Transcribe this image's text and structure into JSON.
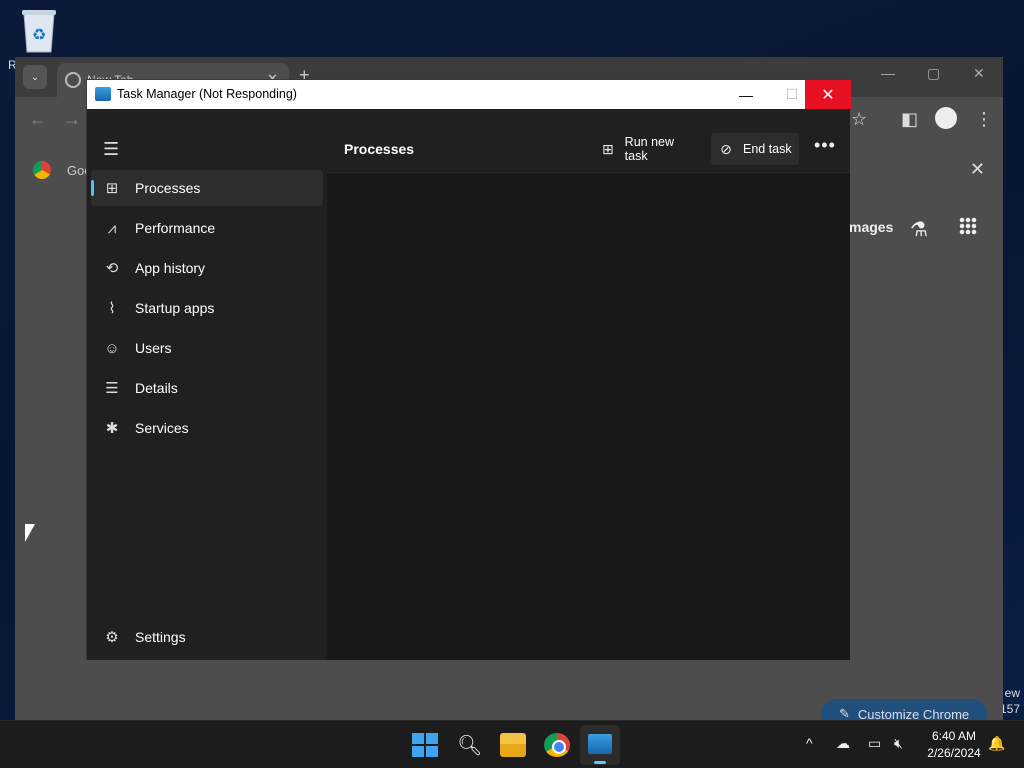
{
  "desktop": {
    "recycle_label": "R",
    "right_text_1": "ew",
    "right_text_2": "157"
  },
  "chrome": {
    "tab_title": "New Tab",
    "tab_close": "✕",
    "new_tab": "+",
    "win_min": "—",
    "win_max": "▢",
    "win_close": "✕",
    "back": "←",
    "forward": "→",
    "bookmark_label": "Goo",
    "bookmark_close": "✕",
    "images_link": "mages",
    "labs_icon": "⚗",
    "customize_label": "Customize Chrome",
    "star_icon": "☆"
  },
  "task_manager": {
    "window_title": "Task Manager (Not Responding)",
    "min_btn": "—",
    "max_btn": "☐",
    "close_btn": "✕",
    "page_title": "Processes",
    "run_new_task": "Run new task",
    "end_task": "End task",
    "more": "•••",
    "nav": [
      {
        "label": "Processes",
        "icon": "processes-icon",
        "glyph": "⊞"
      },
      {
        "label": "Performance",
        "icon": "performance-icon",
        "glyph": "⩘"
      },
      {
        "label": "App history",
        "icon": "history-icon",
        "glyph": "⟲"
      },
      {
        "label": "Startup apps",
        "icon": "startup-icon",
        "glyph": "⌇"
      },
      {
        "label": "Users",
        "icon": "users-icon",
        "glyph": "☺"
      },
      {
        "label": "Details",
        "icon": "details-icon",
        "glyph": "☰"
      },
      {
        "label": "Services",
        "icon": "services-icon",
        "glyph": "✱"
      }
    ],
    "settings": {
      "label": "Settings",
      "icon": "settings-icon",
      "glyph": "⚙"
    },
    "active_nav": "Processes",
    "accent_color": "#4cc2ff"
  },
  "taskbar": {
    "time": "6:40 AM",
    "date": "2/26/2024",
    "tray_chevron": "^",
    "notification_icon": "🔔"
  }
}
